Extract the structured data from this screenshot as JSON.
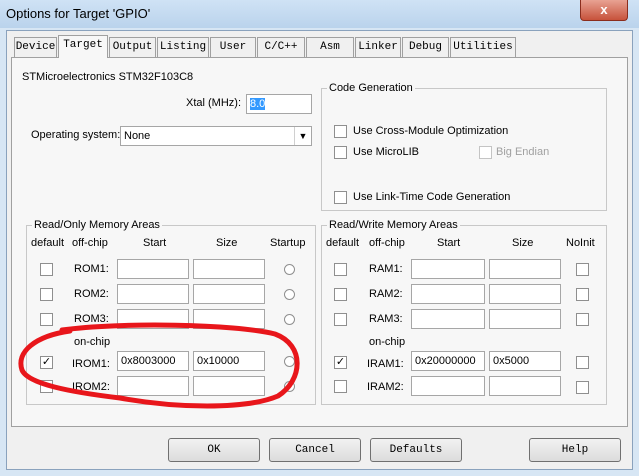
{
  "window": {
    "title": "Options for Target 'GPIO'",
    "close_glyph": "x"
  },
  "tabs": [
    {
      "label": "Device"
    },
    {
      "label": "Target"
    },
    {
      "label": "Output"
    },
    {
      "label": "Listing"
    },
    {
      "label": "User"
    },
    {
      "label": "C/C++"
    },
    {
      "label": "Asm"
    },
    {
      "label": "Linker"
    },
    {
      "label": "Debug"
    },
    {
      "label": "Utilities"
    }
  ],
  "active_tab": "Target",
  "device_name": "STMicroelectronics STM32F103C8",
  "xtal": {
    "label": "Xtal (MHz):",
    "value": "8.0"
  },
  "os": {
    "label": "Operating system:",
    "value": "None"
  },
  "code_generation": {
    "title": "Code Generation",
    "cross_module": {
      "label": "Use Cross-Module Optimization",
      "checked": false
    },
    "microlib": {
      "label": "Use MicroLIB",
      "checked": false
    },
    "big_endian": {
      "label": "Big Endian",
      "checked": false,
      "enabled": false
    },
    "link_time": {
      "label": "Use Link-Time Code Generation",
      "checked": false
    }
  },
  "rom": {
    "title": "Read/Only Memory Areas",
    "headers": {
      "default": "default",
      "offchip": "off-chip",
      "start": "Start",
      "size": "Size",
      "extra": "Startup"
    },
    "onchip_label": "on-chip",
    "rows": [
      {
        "label": "ROM1:",
        "start": "",
        "size": "",
        "default": false
      },
      {
        "label": "ROM2:",
        "start": "",
        "size": "",
        "default": false
      },
      {
        "label": "ROM3:",
        "start": "",
        "size": "",
        "default": false
      },
      {
        "label": "IROM1:",
        "start": "0x8003000",
        "size": "0x10000",
        "default": true
      },
      {
        "label": "IROM2:",
        "start": "",
        "size": "",
        "default": false
      }
    ]
  },
  "ram": {
    "title": "Read/Write Memory Areas",
    "headers": {
      "default": "default",
      "offchip": "off-chip",
      "start": "Start",
      "size": "Size",
      "extra": "NoInit"
    },
    "onchip_label": "on-chip",
    "rows": [
      {
        "label": "RAM1:",
        "start": "",
        "size": "",
        "default": false
      },
      {
        "label": "RAM2:",
        "start": "",
        "size": "",
        "default": false
      },
      {
        "label": "RAM3:",
        "start": "",
        "size": "",
        "default": false
      },
      {
        "label": "IRAM1:",
        "start": "0x20000000",
        "size": "0x5000",
        "default": true
      },
      {
        "label": "IRAM2:",
        "start": "",
        "size": "",
        "default": false
      }
    ]
  },
  "buttons": {
    "ok": "OK",
    "cancel": "Cancel",
    "defaults": "Defaults",
    "help": "Help"
  },
  "checkmark_glyph": "✓",
  "dropdown_glyph": "▼",
  "annotation_color": "#e8161b"
}
